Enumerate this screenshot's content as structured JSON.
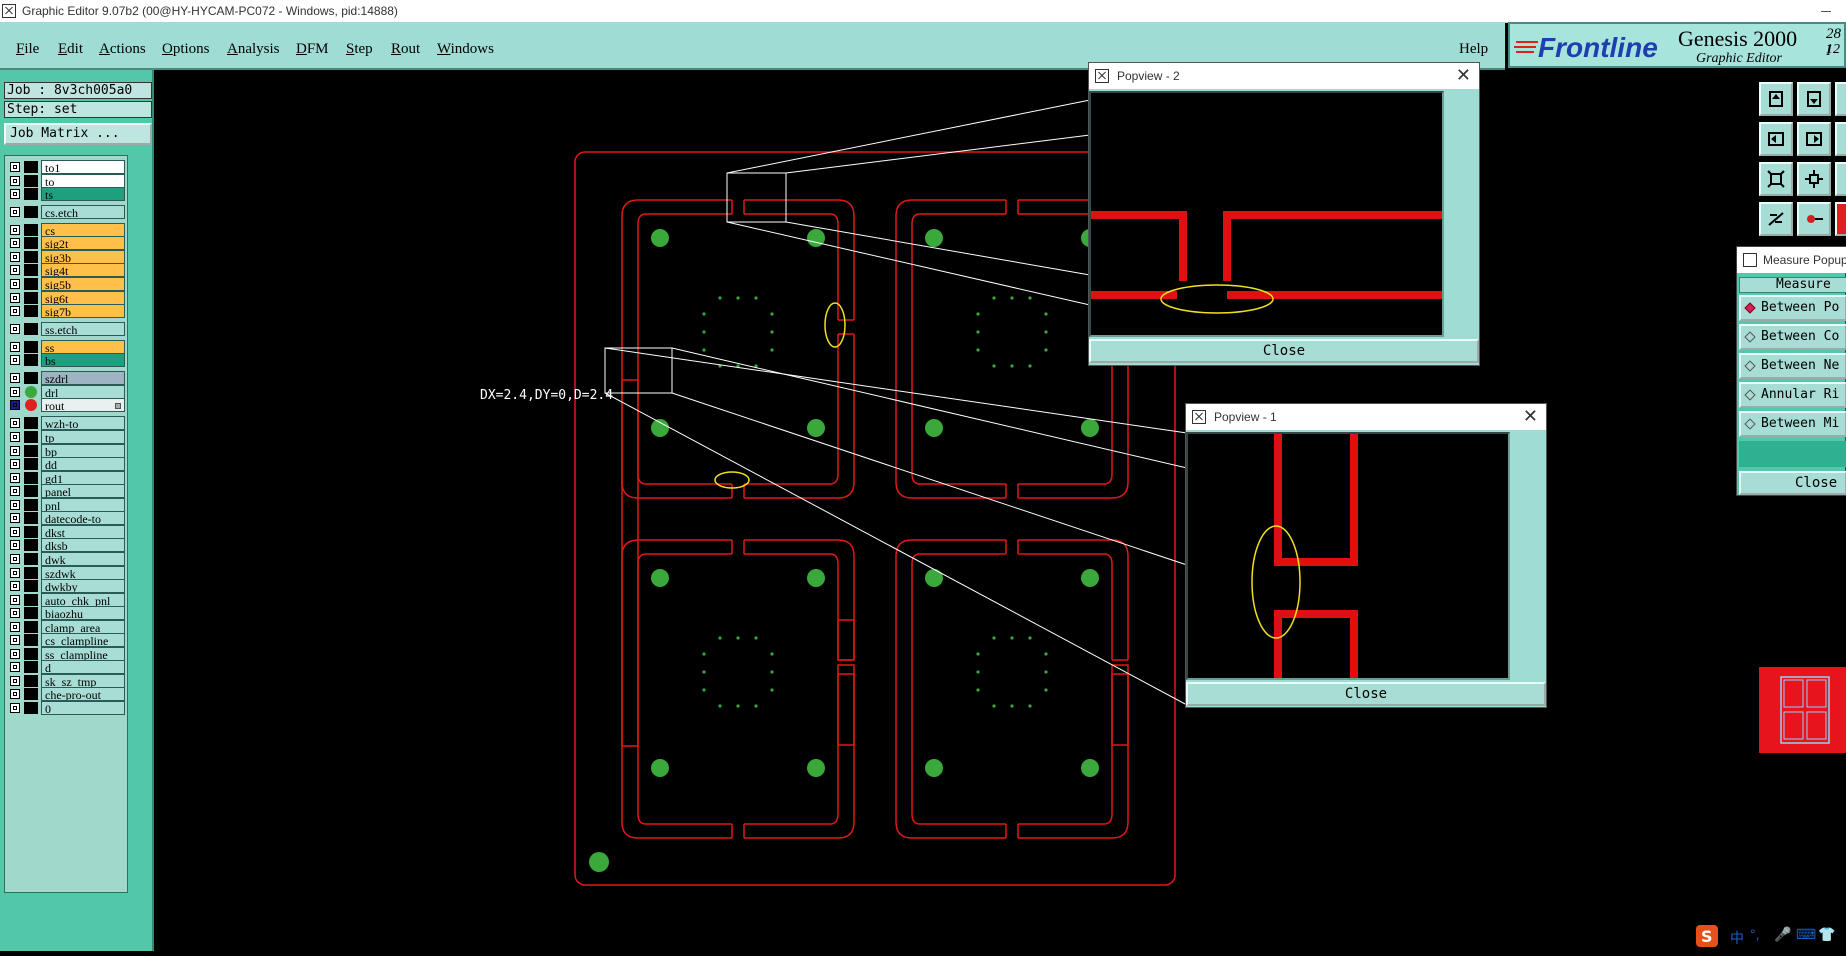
{
  "window": {
    "title": "Graphic Editor 9.07b2 (00@HY-HYCAM-PC072 - Windows, pid:14888)"
  },
  "menu": {
    "items": [
      {
        "u": "F",
        "rest": "ile"
      },
      {
        "u": "E",
        "rest": "dit"
      },
      {
        "u": "A",
        "rest": "ctions"
      },
      {
        "u": "O",
        "rest": "ptions"
      },
      {
        "u": "A",
        "rest": "nalysis"
      },
      {
        "u": "D",
        "rest": "FM"
      },
      {
        "u": "S",
        "rest": "tep"
      },
      {
        "u": "R",
        "rest": "out"
      },
      {
        "u": "W",
        "rest": "indows"
      }
    ],
    "help": "Help"
  },
  "logo": {
    "brand": "Frontline",
    "product": "Genesis 2000",
    "subtitle": "Graphic Editor",
    "corner_top": "28 I",
    "corner_bottom": "12"
  },
  "job": {
    "job_label": "Job : 8v3ch005a0",
    "step_label": "Step: set",
    "matrix_button": "Job Matrix ..."
  },
  "layers": [
    {
      "name": "to1",
      "color": "#ffffff",
      "text": "#000"
    },
    {
      "name": "to",
      "color": "#ffffff",
      "text": "#000"
    },
    {
      "name": "ts",
      "color": "#1ea07e",
      "text": "#000"
    },
    {
      "name": "cs.etch",
      "color": "#a8ddd5",
      "text": "#000"
    },
    {
      "name": "cs",
      "color": "#ffc04a",
      "text": "#000"
    },
    {
      "name": "sig2t",
      "color": "#ffc04a",
      "text": "#000"
    },
    {
      "name": "sig3b",
      "color": "#ffc04a",
      "text": "#000"
    },
    {
      "name": "sig4t",
      "color": "#ffc04a",
      "text": "#000"
    },
    {
      "name": "sig5b",
      "color": "#ffc04a",
      "text": "#000"
    },
    {
      "name": "sig6t",
      "color": "#ffc04a",
      "text": "#000"
    },
    {
      "name": "sig7b",
      "color": "#ffc04a",
      "text": "#000"
    },
    {
      "name": "ss.etch",
      "color": "#a8ddd5",
      "text": "#000"
    },
    {
      "name": "ss",
      "color": "#ffc04a",
      "text": "#000"
    },
    {
      "name": "bs",
      "color": "#1ea07e",
      "text": "#000"
    },
    {
      "name": "szdrl",
      "color": "#9fb4c2",
      "text": "#000"
    },
    {
      "name": "drl",
      "color": "#a8ddd5",
      "text": "#000",
      "dot": "#3aa83a"
    },
    {
      "name": "rout",
      "color": "#e8f0f0",
      "text": "#000",
      "dot": "#e02020",
      "marked": true
    },
    {
      "name": "wzh-to",
      "color": "#a8ddd5",
      "text": "#000"
    },
    {
      "name": "tp",
      "color": "#a8ddd5",
      "text": "#000"
    },
    {
      "name": "bp",
      "color": "#a8ddd5",
      "text": "#000"
    },
    {
      "name": "dd",
      "color": "#a8ddd5",
      "text": "#000"
    },
    {
      "name": "gd1",
      "color": "#a8ddd5",
      "text": "#000"
    },
    {
      "name": "panel",
      "color": "#a8ddd5",
      "text": "#000"
    },
    {
      "name": "pnl",
      "color": "#a8ddd5",
      "text": "#000"
    },
    {
      "name": "datecode-to",
      "color": "#a8ddd5",
      "text": "#000"
    },
    {
      "name": "dkst",
      "color": "#a8ddd5",
      "text": "#000"
    },
    {
      "name": "dksb",
      "color": "#a8ddd5",
      "text": "#000"
    },
    {
      "name": "dwk",
      "color": "#a8ddd5",
      "text": "#000"
    },
    {
      "name": "szdwk",
      "color": "#a8ddd5",
      "text": "#000"
    },
    {
      "name": "dwkby",
      "color": "#a8ddd5",
      "text": "#000"
    },
    {
      "name": "auto_chk_pnl",
      "color": "#a8ddd5",
      "text": "#000"
    },
    {
      "name": "biaozhu",
      "color": "#a8ddd5",
      "text": "#000"
    },
    {
      "name": "clamp_area",
      "color": "#a8ddd5",
      "text": "#000"
    },
    {
      "name": "cs_clampline",
      "color": "#a8ddd5",
      "text": "#000"
    },
    {
      "name": "ss_clampline",
      "color": "#a8ddd5",
      "text": "#000"
    },
    {
      "name": "d",
      "color": "#a8ddd5",
      "text": "#000"
    },
    {
      "name": "sk_sz_tmp",
      "color": "#a8ddd5",
      "text": "#000"
    },
    {
      "name": "che-pro-out",
      "color": "#a8ddd5",
      "text": "#000"
    },
    {
      "name": "0",
      "color": "#a8ddd5",
      "text": "#000"
    }
  ],
  "measurement_text": "DX=2.4,DY=0,D=2.4",
  "popview2": {
    "title": "Popview - 2",
    "close": "Close"
  },
  "popview1": {
    "title": "Popview - 1",
    "close": "Close"
  },
  "measure": {
    "title": "Measure Popup",
    "header": "Measure",
    "options": [
      "Between Po",
      "Between Co",
      "Between Ne",
      "Annular Ri",
      "Between Mi"
    ],
    "close": "Close"
  },
  "tray": {
    "ime": "中"
  },
  "colors": {
    "canvas": "#000000",
    "rout": "#e01818",
    "drill": "#3aa83a",
    "highlight": "#f0e020",
    "menu_bg": "#9fdcd4",
    "panel_bg": "#52c8a8"
  }
}
